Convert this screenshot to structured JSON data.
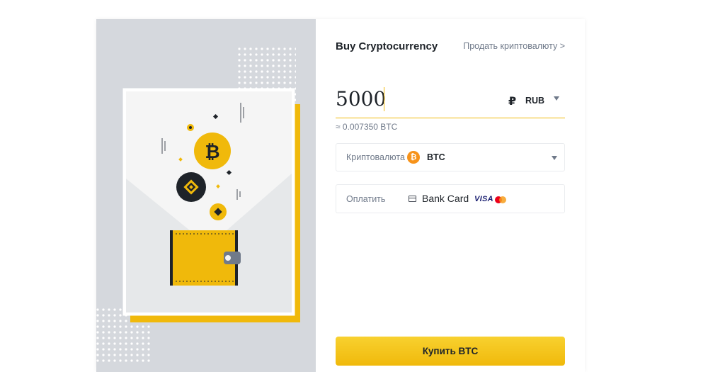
{
  "header": {
    "title": "Buy Cryptocurrency",
    "sell_link": "Продать криптовалюту >"
  },
  "amount": {
    "value": "5000",
    "currency_symbol": "₽",
    "currency_code": "RUB",
    "approx": "≈ 0.007350 BTC"
  },
  "crypto_select": {
    "label": "Криптовалюта",
    "coin_icon": "bitcoin-icon",
    "coin_glyph": "₿",
    "value": "BTC"
  },
  "payment": {
    "label": "Оплатить",
    "icon": "card-icon",
    "value": "Bank Card",
    "visa": "VISA"
  },
  "buy_button": {
    "label": "Купить BTC"
  },
  "colors": {
    "accent": "#f0b90b",
    "illustration_bg": "#d5d8dd",
    "bitcoin": "#f7931a",
    "text_primary": "#1e2329",
    "text_secondary": "#707a8a"
  }
}
